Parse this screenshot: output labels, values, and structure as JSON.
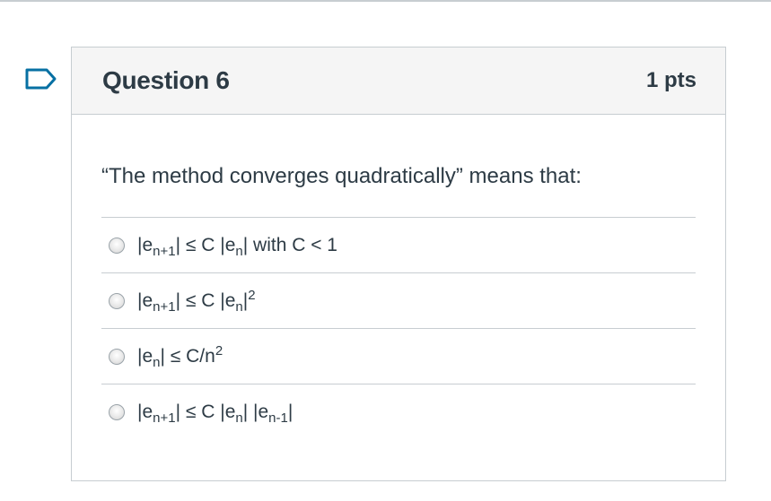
{
  "question": {
    "title": "Question 6",
    "points": "1 pts",
    "text": "“The method converges quadratically” means that:",
    "flag_icon": "bookmark-flag-icon"
  },
  "answers": [
    {
      "parts": [
        {
          "t": "|e"
        },
        {
          "sub": "n+1"
        },
        {
          "t": "| ≤ C |e"
        },
        {
          "sub": "n"
        },
        {
          "t": "| with C < 1"
        }
      ]
    },
    {
      "parts": [
        {
          "t": "|e"
        },
        {
          "sub": "n+1"
        },
        {
          "t": "| ≤ C |e"
        },
        {
          "sub": "n"
        },
        {
          "t": "|"
        },
        {
          "sup": "2"
        }
      ]
    },
    {
      "parts": [
        {
          "t": "|e"
        },
        {
          "sub": "n"
        },
        {
          "t": "| ≤ C/n"
        },
        {
          "sup": "2"
        }
      ]
    },
    {
      "parts": [
        {
          "t": "|e"
        },
        {
          "sub": "n+1"
        },
        {
          "t": "| ≤ C |e"
        },
        {
          "sub": "n"
        },
        {
          "t": "| |e"
        },
        {
          "sub": "n-1"
        },
        {
          "t": "|"
        }
      ]
    }
  ]
}
